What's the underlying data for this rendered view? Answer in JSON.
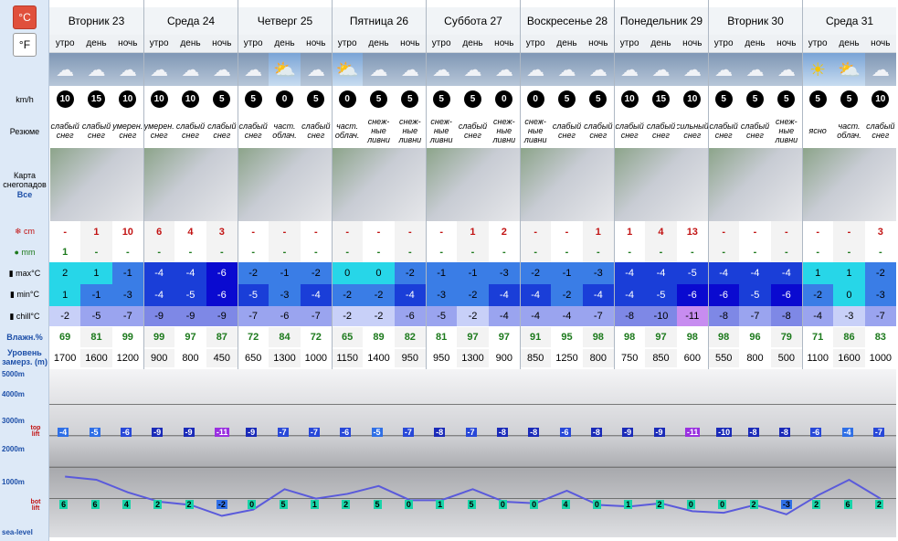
{
  "units": {
    "c": "°C",
    "f": "°F"
  },
  "labels": {
    "wind": "km/h",
    "summary": "Резюме",
    "map1": "Карта",
    "map2": "снегопадов",
    "map3": "Все",
    "snow": "cm",
    "rain": "mm",
    "max": "max°C",
    "min": "min°C",
    "chill": "chill°C",
    "hum": "Влажн.%",
    "lvl1": "Уровень",
    "lvl2": "замерз. (m)"
  },
  "days": [
    "Вторник 23",
    "Среда 24",
    "Четверг 25",
    "Пятница 26",
    "Суббота 27",
    "Воскресенье 28",
    "Понедельник 29",
    "Вторник 30",
    "Среда 31"
  ],
  "tods": [
    "утро",
    "день",
    "ночь"
  ],
  "wind": [
    "10",
    "15",
    "10",
    "10",
    "10",
    "5",
    "5",
    "0",
    "5",
    "0",
    "5",
    "5",
    "5",
    "5",
    "0",
    "0",
    "5",
    "5",
    "10",
    "15",
    "10",
    "5",
    "5",
    "5",
    "5",
    "5",
    "10"
  ],
  "summary": [
    "слабый снег",
    "слабый снег",
    "умерен. снег",
    "умерен. снег",
    "слабый снег",
    "слабый снег",
    "слабый снег",
    "част. облач.",
    "слабый снег",
    "част. облач.",
    "снеж- ные ливни",
    "снеж- ные ливни",
    "снеж- ные ливни",
    "слабый снег",
    "снеж- ные ливни",
    "снеж- ные ливни",
    "слабый снег",
    "слабый снег",
    "слабый снег",
    "слабый снег",
    "сильный снег",
    "слабый снег",
    "слабый снег",
    "снеж- ные ливни",
    "ясно",
    "част. облач.",
    "слабый снег"
  ],
  "snow": [
    "-",
    "1",
    "10",
    "6",
    "4",
    "3",
    "-",
    "-",
    "-",
    "-",
    "-",
    "-",
    "-",
    "1",
    "2",
    "-",
    "-",
    "1",
    "1",
    "4",
    "13",
    "-",
    "-",
    "-",
    "-",
    "-",
    "3"
  ],
  "rain": [
    "1",
    "-",
    "-",
    "-",
    "-",
    "-",
    "-",
    "-",
    "-",
    "-",
    "-",
    "-",
    "-",
    "-",
    "-",
    "-",
    "-",
    "-",
    "-",
    "-",
    "-",
    "-",
    "-",
    "-",
    "-",
    "-",
    "-"
  ],
  "max": [
    "2",
    "1",
    "-1",
    "-4",
    "-4",
    "-6",
    "-2",
    "-1",
    "-2",
    "0",
    "0",
    "-2",
    "-1",
    "-1",
    "-3",
    "-2",
    "-1",
    "-3",
    "-4",
    "-4",
    "-5",
    "-4",
    "-4",
    "-4",
    "1",
    "1",
    "-2"
  ],
  "min": [
    "1",
    "-1",
    "-3",
    "-4",
    "-5",
    "-6",
    "-5",
    "-3",
    "-4",
    "-2",
    "-2",
    "-4",
    "-3",
    "-2",
    "-4",
    "-4",
    "-2",
    "-4",
    "-4",
    "-5",
    "-6",
    "-6",
    "-5",
    "-6",
    "-2",
    "0",
    "-3"
  ],
  "chill": [
    "-2",
    "-5",
    "-7",
    "-9",
    "-9",
    "-9",
    "-7",
    "-6",
    "-7",
    "-2",
    "-2",
    "-6",
    "-5",
    "-2",
    "-4",
    "-4",
    "-4",
    "-7",
    "-8",
    "-10",
    "-11",
    "-8",
    "-7",
    "-8",
    "-4",
    "-3",
    "-7"
  ],
  "hum": [
    "69",
    "81",
    "99",
    "99",
    "97",
    "87",
    "72",
    "84",
    "72",
    "65",
    "89",
    "82",
    "81",
    "97",
    "97",
    "91",
    "95",
    "98",
    "98",
    "97",
    "98",
    "98",
    "96",
    "79",
    "71",
    "86",
    "83"
  ],
  "freeze": [
    "1700",
    "1600",
    "1200",
    "900",
    "800",
    "450",
    "650",
    "1300",
    "1000",
    "1150",
    "1400",
    "950",
    "950",
    "1300",
    "900",
    "850",
    "1250",
    "800",
    "750",
    "850",
    "600",
    "550",
    "800",
    "500",
    "1100",
    "1600",
    "1000"
  ],
  "alt": [
    "5000m",
    "4000m",
    "3000m",
    "2000m",
    "1000m",
    "sea-level"
  ],
  "toplift": "top lift",
  "botlift": "bot lift",
  "top_temps": [
    "-4",
    "-5",
    "-6",
    "-9",
    "-9",
    "-11",
    "-9",
    "-7",
    "-7",
    "-6",
    "-5",
    "-7",
    "-8",
    "-7",
    "-8",
    "-8",
    "-6",
    "-8",
    "-9",
    "-9",
    "-11",
    "-10",
    "-8",
    "-8",
    "-6",
    "-4",
    "-7"
  ],
  "bot_temps": [
    "6",
    "6",
    "4",
    "2",
    "2",
    "-2",
    "0",
    "5",
    "1",
    "2",
    "5",
    "0",
    "1",
    "5",
    "0",
    "0",
    "4",
    "0",
    "1",
    "2",
    "0",
    "0",
    "2",
    "-3",
    "2",
    "6",
    "2"
  ],
  "colors": {
    "warm": "#27d6e8",
    "cool": "#3a7de6",
    "cold": "#1a3ed8",
    "vcold": "#0a0ad0",
    "chill_pale": "#c8d0f8",
    "chill_mid": "#9aa4ef",
    "chill_dark": "#7e88e6",
    "purple": "#c78cf0",
    "line": "#5a5adb"
  }
}
